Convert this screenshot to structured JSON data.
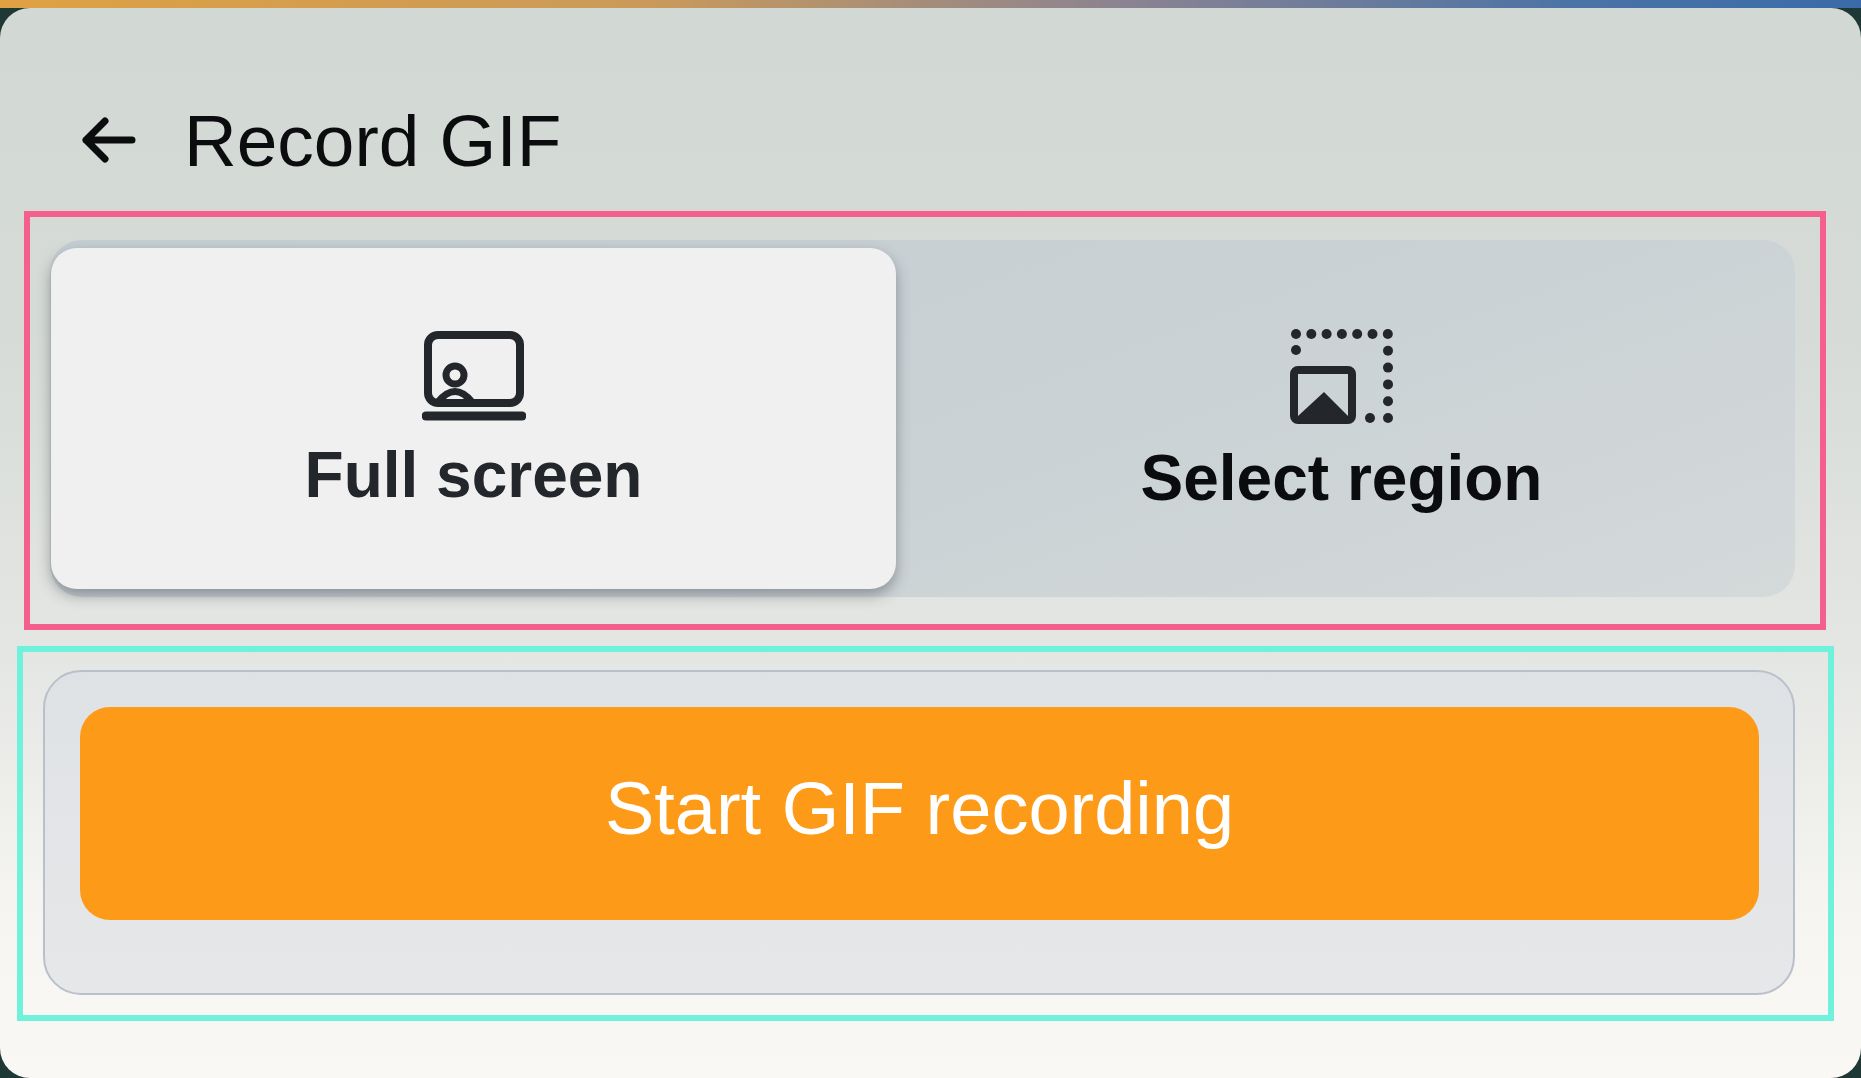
{
  "header": {
    "title": "Record GIF"
  },
  "capture_modes": [
    {
      "label": "Full screen",
      "kind": "full_screen",
      "selected": true
    },
    {
      "label": "Select region",
      "kind": "region",
      "selected": false
    }
  ],
  "start_button": {
    "label": "Start GIF recording"
  }
}
